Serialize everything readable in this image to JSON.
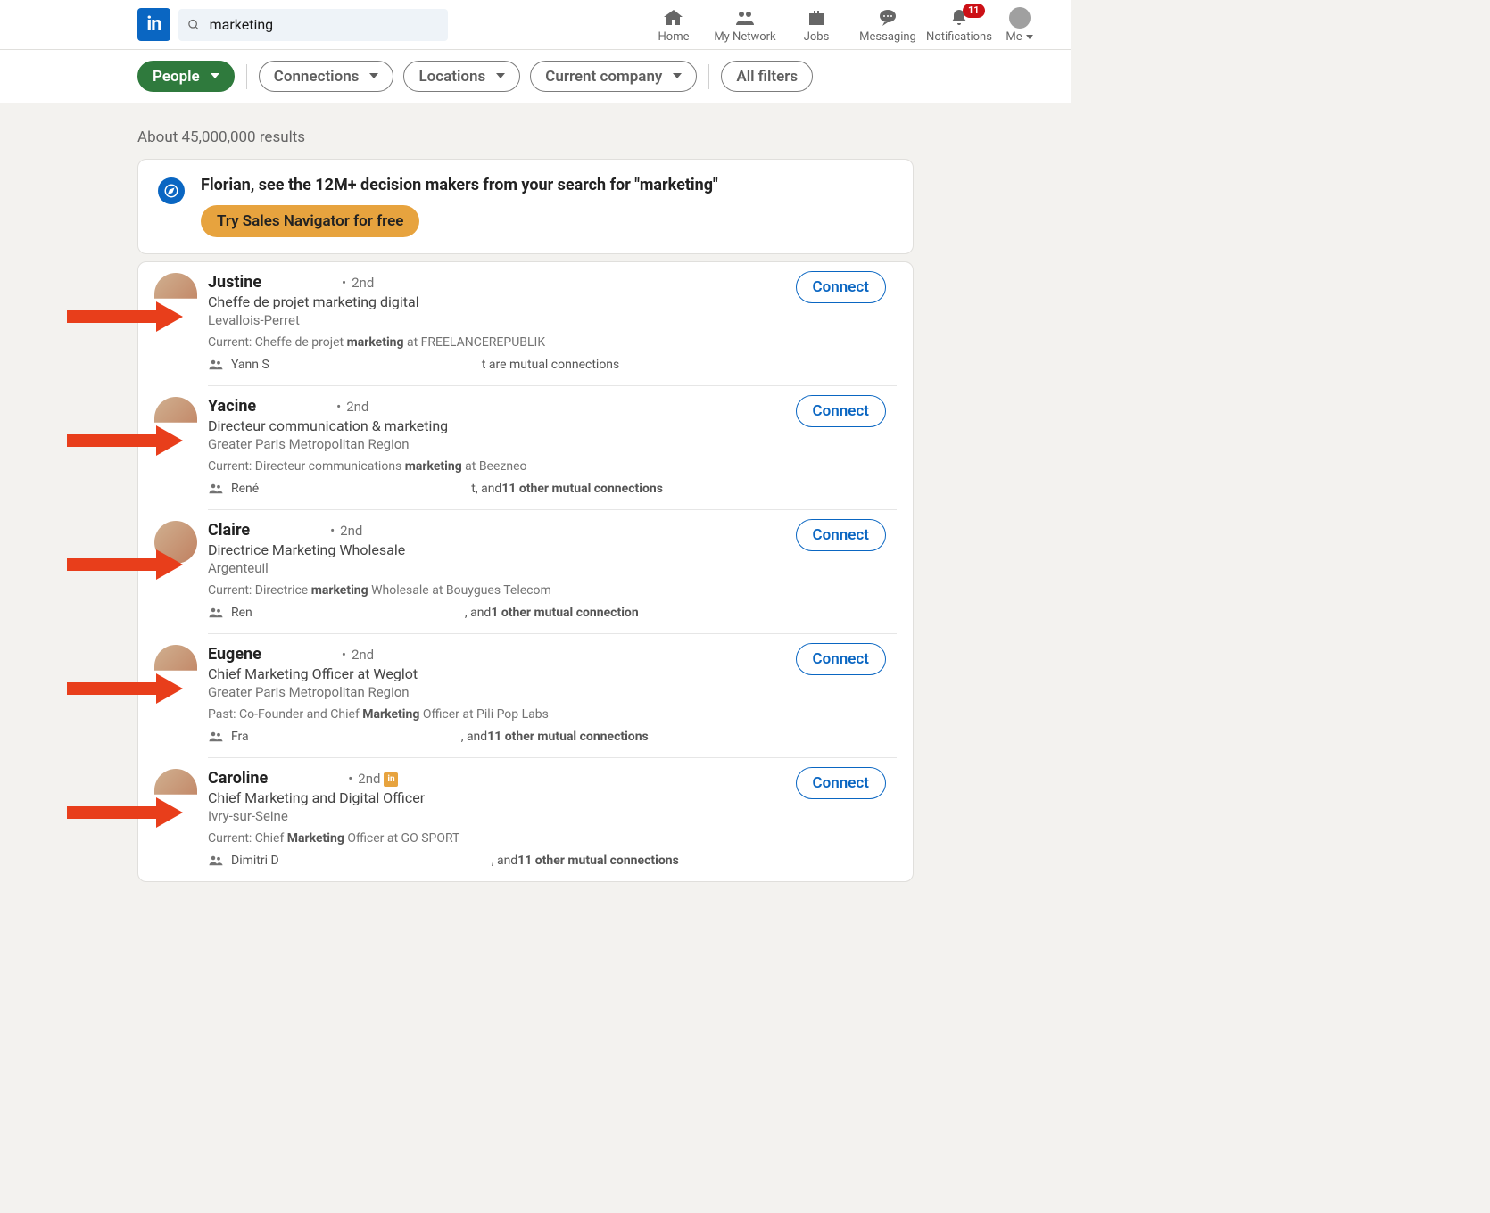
{
  "search": {
    "value": "marketing"
  },
  "nav": {
    "home": "Home",
    "network": "My Network",
    "jobs": "Jobs",
    "messaging": "Messaging",
    "notifications": "Notifications",
    "notifications_badge": "11",
    "me": "Me"
  },
  "filters": {
    "people": "People",
    "connections": "Connections",
    "locations": "Locations",
    "company": "Current company",
    "all": "All filters"
  },
  "results_count": "About 45,000,000 results",
  "promo": {
    "title": "Florian, see the 12M+ decision makers from your search for \"marketing\"",
    "cta": "Try Sales Navigator for free"
  },
  "connect_label": "Connect",
  "results": [
    {
      "name": "Justine",
      "degree": "2nd",
      "headline": "Cheffe de projet marketing digital",
      "location": "Levallois-Perret",
      "current_prefix": "Current: Cheffe de projet ",
      "current_bold": "marketing",
      "current_suffix": " at FREELANCEREPUBLIK",
      "mutual_prefix": "Yann S",
      "mutual_suffix": "t are mutual connections",
      "premium": false,
      "half_avatar": true
    },
    {
      "name": "Yacine",
      "degree": "2nd",
      "headline": "Directeur communication & marketing",
      "location": "Greater Paris Metropolitan Region",
      "current_prefix": "Current: Directeur communications ",
      "current_bold": "marketing",
      "current_suffix": " at Beezneo",
      "mutual_prefix": "René",
      "mutual_mid": "t, and ",
      "mutual_bold": "11 other mutual connections",
      "premium": false,
      "half_avatar": true
    },
    {
      "name": "Claire",
      "degree": "2nd",
      "headline": "Directrice Marketing Wholesale",
      "location": "Argenteuil",
      "current_prefix": "Current: Directrice ",
      "current_bold": "marketing",
      "current_suffix": " Wholesale at Bouygues Telecom",
      "mutual_prefix": "Ren",
      "mutual_mid": ", and ",
      "mutual_bold": "1 other mutual connection",
      "premium": false,
      "half_avatar": false
    },
    {
      "name": "Eugene",
      "degree": "2nd",
      "headline": "Chief Marketing Officer at Weglot",
      "location": "Greater Paris Metropolitan Region",
      "current_prefix": "Past: Co-Founder and Chief ",
      "current_bold": "Marketing",
      "current_suffix": " Officer at Pili Pop Labs",
      "mutual_prefix": "Fra",
      "mutual_mid": ", and ",
      "mutual_bold": "11 other mutual connections",
      "premium": false,
      "half_avatar": true
    },
    {
      "name": "Caroline",
      "degree": "2nd",
      "headline": "Chief Marketing and Digital Officer",
      "location": "Ivry-sur-Seine",
      "current_prefix": "Current: Chief ",
      "current_bold": "Marketing",
      "current_suffix": " Officer at GO SPORT",
      "mutual_prefix": "Dimitri D",
      "mutual_mid": ", and ",
      "mutual_bold": "11 other mutual connections",
      "premium": true,
      "half_avatar": true
    }
  ]
}
